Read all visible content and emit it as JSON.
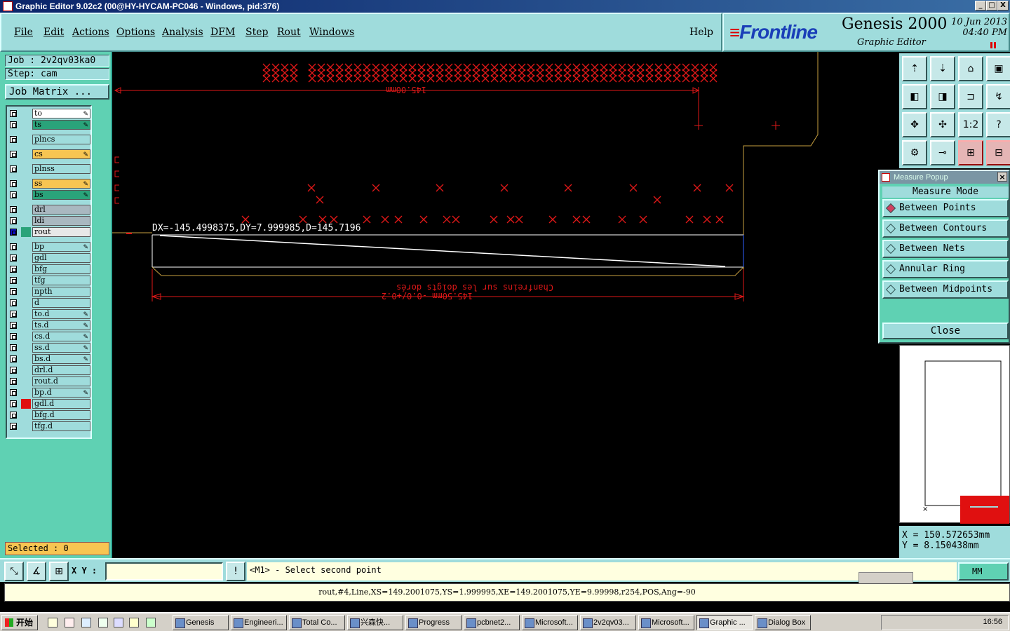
{
  "window": {
    "title": "Graphic Editor 9.02c2 (00@HY-HYCAM-PC046 - Windows, pid:376)",
    "controls": [
      "_",
      "□",
      "X"
    ]
  },
  "menu": {
    "items": [
      "File",
      "Edit",
      "Actions",
      "Options",
      "Analysis",
      "DFM",
      "Step",
      "Rout",
      "Windows"
    ],
    "help": "Help"
  },
  "brand": {
    "logo": "Frontline",
    "product": "Genesis 2000",
    "subtitle": "Graphic Editor",
    "date": "10 Jun 2013",
    "time": "04:40 PM"
  },
  "job": {
    "job_line": "Job : 2v2qv03ka0",
    "step_line": "Step: cam",
    "matrix_button": "Job Matrix ..."
  },
  "layers": [
    {
      "name": "to",
      "color": "#ffffff",
      "edit": true
    },
    {
      "name": "ts",
      "color": "#2aa37a",
      "edit": true
    },
    {
      "name": "plncs",
      "color": "#9fdcdc",
      "edit": false
    },
    {
      "name": "cs",
      "color": "#f7c552",
      "edit": true
    },
    {
      "name": "plnss",
      "color": "#9fdcdc",
      "edit": false
    },
    {
      "name": "ss",
      "color": "#f7c552",
      "edit": true
    },
    {
      "name": "bs",
      "color": "#2aa37a",
      "edit": true
    },
    {
      "name": "drl",
      "color": "#a9b8c0",
      "edit": false
    },
    {
      "name": "ldi",
      "color": "#a9b8c0",
      "edit": false
    },
    {
      "name": "rout",
      "color": "#e8e8e8",
      "edit": false,
      "active": true
    },
    {
      "name": "bp",
      "color": "#9fdcdc",
      "edit": true
    },
    {
      "name": "gdl",
      "color": "#9fdcdc",
      "edit": false
    },
    {
      "name": "bfg",
      "color": "#9fdcdc",
      "edit": false
    },
    {
      "name": "tfg",
      "color": "#9fdcdc",
      "edit": false
    },
    {
      "name": "npth",
      "color": "#9fdcdc",
      "edit": false
    },
    {
      "name": "d",
      "color": "#9fdcdc",
      "edit": false
    },
    {
      "name": "to.d",
      "color": "#9fdcdc",
      "edit": true
    },
    {
      "name": "ts.d",
      "color": "#9fdcdc",
      "edit": true
    },
    {
      "name": "cs.d",
      "color": "#9fdcdc",
      "edit": true
    },
    {
      "name": "ss.d",
      "color": "#9fdcdc",
      "edit": true
    },
    {
      "name": "bs.d",
      "color": "#9fdcdc",
      "edit": true
    },
    {
      "name": "drl.d",
      "color": "#9fdcdc",
      "edit": false
    },
    {
      "name": "rout.d",
      "color": "#9fdcdc",
      "edit": false
    },
    {
      "name": "bp.d",
      "color": "#9fdcdc",
      "edit": true
    },
    {
      "name": "gdl.d",
      "color": "#9fdcdc",
      "edit": false,
      "swatch": "#e01010"
    },
    {
      "name": "bfg.d",
      "color": "#9fdcdc",
      "edit": false
    },
    {
      "name": "tfg.d",
      "color": "#9fdcdc",
      "edit": false
    }
  ],
  "selected": "Selected : 0",
  "canvas": {
    "measure_readout": "DX=-145.4998375,DY=7.999985,D=145.7196",
    "dim_top": "145.00mm",
    "dim_bottom": "145.50mm -0.0/+0.2",
    "note": "Chanfreins sur les doigts dorés",
    "colors": {
      "feature": "#e01818",
      "outline": "#ffffff",
      "rout": "#c8a040"
    }
  },
  "tools": [
    "⇡",
    "⇣",
    "⌂",
    "▣",
    "◧",
    "◨",
    "⊐",
    "↯",
    "✥",
    "✣",
    "1:2",
    "?",
    "⚙",
    "⊸",
    "⊞",
    "⊟"
  ],
  "measure_popup": {
    "title": "Measure Popup",
    "mode_title": "Measure Mode",
    "options": [
      "Between Points",
      "Between Contours",
      "Between Nets",
      "Annular Ring",
      "Between Midpoints"
    ],
    "selected_index": 0,
    "close": "Close"
  },
  "coords": {
    "x": "X = 150.572653mm",
    "y": "Y = 8.150438mm"
  },
  "input": {
    "xy_label": "X Y :",
    "xy_value": "",
    "prompt": "<M1> - Select second point",
    "units": "MM"
  },
  "status_line": "rout,#4,Line,XS=149.2001075,YS=1.999995,XE=149.2001075,YE=9.99998,r254,POS,Ang=-90",
  "taskbar": {
    "start": "开始",
    "tasks": [
      "Genesis",
      "Engineeri...",
      "Total Co...",
      "兴森快...",
      "Progress",
      "pcbnet2...",
      "Microsoft...",
      "2v2qv03...",
      "Microsoft...",
      "Graphic ...",
      "Dialog Box"
    ],
    "active_index": 9,
    "clock": "16:56"
  }
}
